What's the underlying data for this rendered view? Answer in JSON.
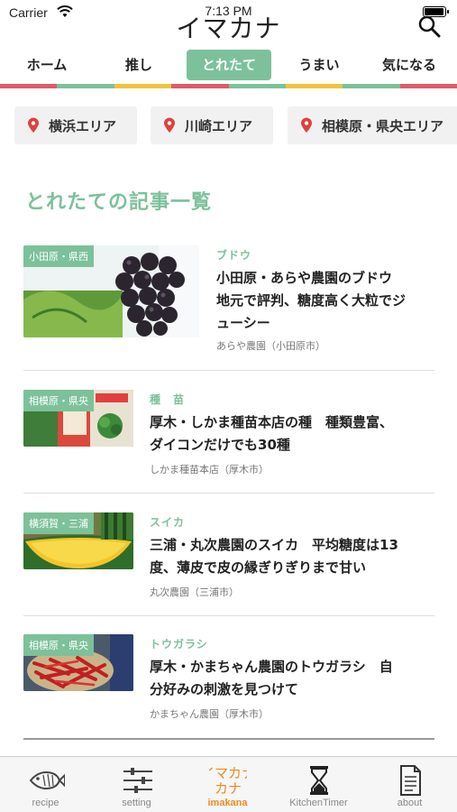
{
  "status_bar": {
    "carrier": "Carrier",
    "time": "7:13 PM"
  },
  "header": {
    "app_title": "イマカナ",
    "search_icon": "search-icon"
  },
  "tabs": [
    {
      "label": "ホーム",
      "active": false
    },
    {
      "label": "推し",
      "active": false
    },
    {
      "label": "とれたて",
      "active": true
    },
    {
      "label": "うまい",
      "active": false
    },
    {
      "label": "気になる",
      "active": false
    }
  ],
  "colors": {
    "accent": "#7cc19a",
    "tab_active": "#ef8a1f",
    "stripe": [
      "#e05a6a",
      "#7cc19a",
      "#f0c33c",
      "#e05a6a",
      "#7cc19a",
      "#f0c33c",
      "#7cc19a",
      "#e05a6a"
    ]
  },
  "areas": [
    {
      "label": "横浜エリア",
      "icon": "location-pin-icon"
    },
    {
      "label": "川崎エリア",
      "icon": "location-pin-icon"
    },
    {
      "label": "相模原・県央エリア",
      "icon": "location-pin-icon"
    }
  ],
  "section_title": "とれたての記事一覧",
  "articles": [
    {
      "badge": "小田原・県西",
      "category": "ブドウ",
      "title_lines": [
        "小田原・あらや農園のブドウ",
        "地元で評判、糖度高く大粒でジ",
        "ューシー"
      ],
      "source": "あらや農園（小田原市）",
      "image": "grape-photo"
    },
    {
      "badge": "相模原・県央",
      "category": "種　苗",
      "title_lines": [
        "厚木・しかま種苗本店の種　種類豊富、",
        "ダイコンだけでも30種"
      ],
      "source": "しかま種苗本店（厚木市）",
      "image": "seed-packets-photo"
    },
    {
      "badge": "横須賀・三浦",
      "category": "スイカ",
      "title_lines": [
        "三浦・丸次農園のスイカ　平均糖度は13",
        "度、薄皮で皮の縁ぎりぎりまで甘い"
      ],
      "source": "丸次農園（三浦市）",
      "image": "watermelon-photo"
    },
    {
      "badge": "相模原・県央",
      "category": "トウガラシ",
      "title_lines": [
        "厚木・かまちゃん農園のトウガラシ　自",
        "分好みの刺激を見つけて"
      ],
      "source": "かまちゃん農園（厚木市）",
      "image": "chili-pepper-photo"
    }
  ],
  "tab_bar": [
    {
      "label": "recipe",
      "icon": "fish-icon",
      "active": false
    },
    {
      "label": "setting",
      "icon": "sliders-icon",
      "active": false
    },
    {
      "label": "imakana",
      "icon": "imakana-logo-icon",
      "logo_text": "イマカナ",
      "active": true
    },
    {
      "label": "KitchenTimer",
      "icon": "hourglass-icon",
      "active": false
    },
    {
      "label": "about",
      "icon": "document-icon",
      "active": false
    }
  ]
}
